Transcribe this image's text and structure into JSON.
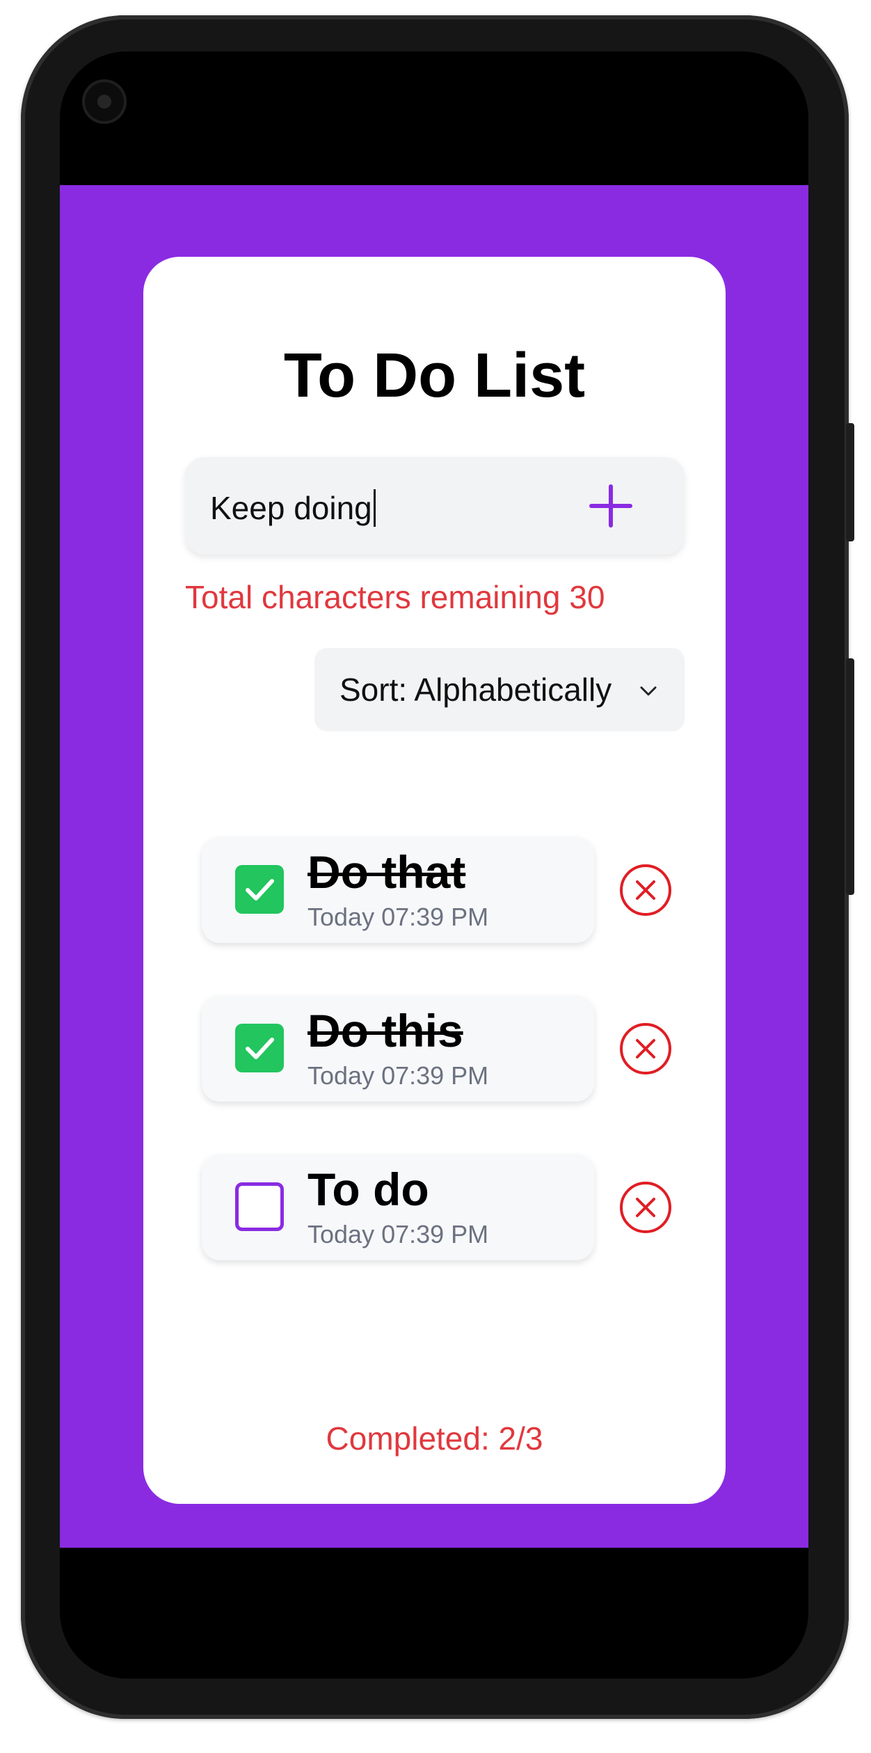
{
  "app": {
    "title": "To Do List",
    "accent_color": "#8a2be2",
    "background_color": "#8a2be2",
    "card_color": "#ffffff"
  },
  "input": {
    "value": "Keep doing",
    "add_icon": "plus-icon"
  },
  "remaining": {
    "text": "Total characters remaining 30",
    "color": "#e0383e"
  },
  "sort": {
    "label": "Sort: Alphabetically",
    "icon": "chevron-down-icon"
  },
  "todos": [
    {
      "text": "Do that",
      "time": "Today 07:39 PM",
      "completed": true
    },
    {
      "text": "Do this",
      "time": "Today 07:39 PM",
      "completed": true
    },
    {
      "text": "To do",
      "time": "Today 07:39 PM",
      "completed": false
    }
  ],
  "checkbox_colors": {
    "checked": "#22c55e",
    "unchecked_border": "#8a2be2"
  },
  "delete_icon": "close-circle-icon",
  "delete_color": "#e01e24",
  "footer": {
    "completed_text": "Completed: 2/3",
    "completed_count": 2,
    "total_count": 3
  }
}
